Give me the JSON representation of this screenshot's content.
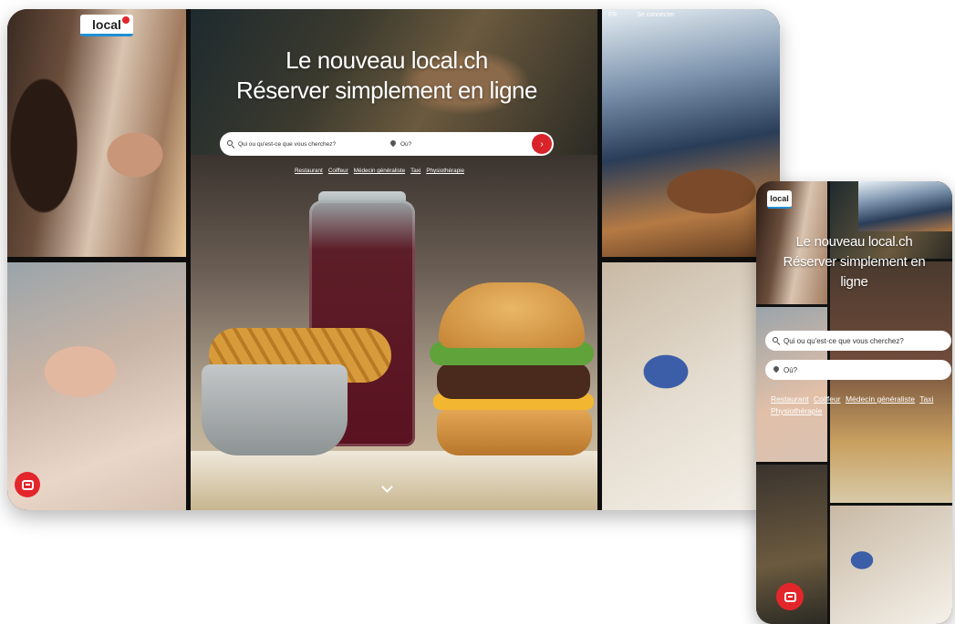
{
  "desktop": {
    "logo": "local",
    "top_links": {
      "language": "FR",
      "login": "Se connecter"
    },
    "hero": {
      "line1": "Le nouveau local.ch",
      "line2": "Réserver simplement en ligne"
    },
    "search": {
      "what_placeholder": "Qui ou qu'est-ce que vous cherchez?",
      "where_placeholder": "Où?",
      "go_icon": "chevron-right-icon"
    },
    "categories": [
      "Restaurant",
      "Coiffeur",
      "Médecin généraliste",
      "Taxi",
      "Physiothérapie"
    ],
    "scroll_icon": "chevron-down-icon",
    "chat_icon": "chat-bot-icon"
  },
  "mobile": {
    "logo": "local",
    "hero": {
      "line1": "Le nouveau local.ch",
      "line2": "Réserver simplement en",
      "line3": "ligne"
    },
    "search": {
      "what_placeholder": "Qui ou qu'est-ce que vous cherchez?",
      "where_placeholder": "Où?"
    },
    "categories": [
      "Restaurant",
      "Coiffeur",
      "Médecin généraliste",
      "Taxi",
      "Physiothérapie"
    ],
    "chat_icon": "chat-bot-icon"
  },
  "colors": {
    "brand_red": "#e3262b",
    "brand_blue": "#1e8fd6"
  }
}
